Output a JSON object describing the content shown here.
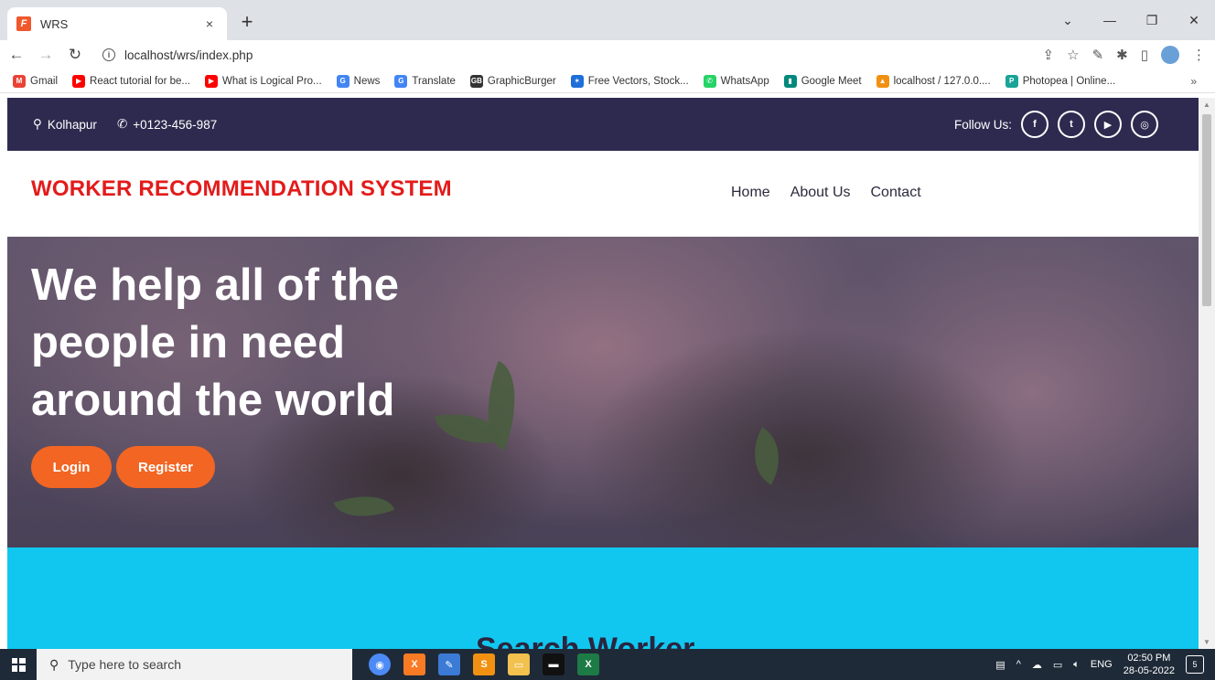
{
  "browser": {
    "tab_title": "WRS",
    "tab_close": "×",
    "new_tab": "+",
    "url": "localhost/wrs/index.php",
    "bookmarks": [
      {
        "label": "Gmail",
        "color": "#ea4335",
        "glyph": "M"
      },
      {
        "label": "React tutorial for be...",
        "color": "#ff0000",
        "glyph": "▶"
      },
      {
        "label": "What is Logical Pro...",
        "color": "#ff0000",
        "glyph": "▶"
      },
      {
        "label": "News",
        "color": "#4285f4",
        "glyph": "G"
      },
      {
        "label": "Translate",
        "color": "#4285f4",
        "glyph": "G"
      },
      {
        "label": "GraphicBurger",
        "color": "#333333",
        "glyph": "GB"
      },
      {
        "label": "Free Vectors, Stock...",
        "color": "#1e6fd9",
        "glyph": "✶"
      },
      {
        "label": "WhatsApp",
        "color": "#25d366",
        "glyph": "✆"
      },
      {
        "label": "Google Meet",
        "color": "#00897b",
        "glyph": "▮"
      },
      {
        "label": "localhost / 127.0.0....",
        "color": "#f29111",
        "glyph": "▲"
      },
      {
        "label": "Photopea | Online...",
        "color": "#18a497",
        "glyph": "P"
      }
    ],
    "bookmarks_more": "»"
  },
  "topbar": {
    "location": "Kolhapur",
    "phone": "+0123-456-987",
    "follow_label": "Follow Us:",
    "socials": [
      "f",
      "t",
      "▶",
      "◎"
    ]
  },
  "header": {
    "brand": "WORKER RECOMMENDATION SYSTEM",
    "nav": [
      "Home",
      "About Us",
      "Contact"
    ]
  },
  "hero": {
    "title_lines": [
      "We help all of the",
      "people in need",
      "around the world"
    ],
    "login_label": "Login",
    "register_label": "Register"
  },
  "search_section": {
    "title": "Search Worker"
  },
  "taskbar": {
    "search_placeholder": "Type here to search",
    "language": "ENG",
    "time": "02:50 PM",
    "date": "28-05-2022",
    "notification_count": "5"
  },
  "colors": {
    "topbar": "#2e2a4f",
    "brand": "#e31b1b",
    "button": "#f26522",
    "search_bg": "#11c7ef"
  }
}
